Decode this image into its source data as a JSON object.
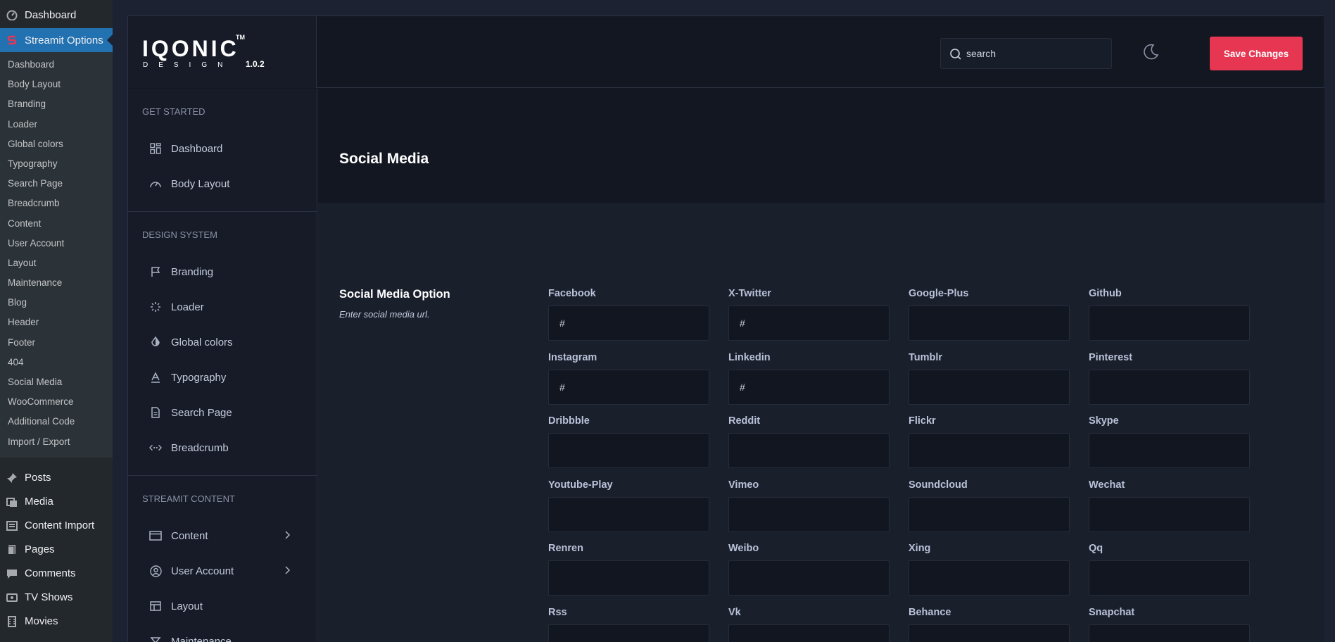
{
  "wp_sidebar": {
    "top_item": {
      "label": "Dashboard",
      "icon": "dashboard-icon"
    },
    "active_item": {
      "label": "Streamit Options",
      "icon": "streamit-icon"
    },
    "submenu": [
      "Dashboard",
      "Body Layout",
      "Branding",
      "Loader",
      "Global colors",
      "Typography",
      "Search Page",
      "Breadcrumb",
      "Content",
      "User Account",
      "Layout",
      "Maintenance",
      "Blog",
      "Header",
      "Footer",
      "404",
      "Social Media",
      "WooCommerce",
      "Additional Code",
      "Import / Export"
    ],
    "menu": [
      {
        "label": "Posts",
        "icon": "pin-icon"
      },
      {
        "label": "Media",
        "icon": "media-icon"
      },
      {
        "label": "Content Import",
        "icon": "import-icon"
      },
      {
        "label": "Pages",
        "icon": "pages-icon"
      },
      {
        "label": "Comments",
        "icon": "comment-icon"
      },
      {
        "label": "TV Shows",
        "icon": "tv-icon"
      },
      {
        "label": "Movies",
        "icon": "film-icon"
      }
    ]
  },
  "brand": {
    "logo_text": "IQONIC",
    "tm": "TM",
    "sub": "DESIGN",
    "version": "1.0.2"
  },
  "topbar": {
    "search_placeholder": "search",
    "save_label": "Save Changes",
    "theme_icon": "moon-icon"
  },
  "colors": {
    "accent": "#e63652",
    "wp_active": "#2271b1",
    "panel_bg": "#131722"
  },
  "nav": {
    "sections": [
      {
        "heading": "GET STARTED",
        "items": [
          {
            "label": "Dashboard",
            "icon": "grid-icon"
          },
          {
            "label": "Body Layout",
            "icon": "gauge-icon"
          }
        ]
      },
      {
        "heading": "DESIGN SYSTEM",
        "items": [
          {
            "label": "Branding",
            "icon": "flag-icon"
          },
          {
            "label": "Loader",
            "icon": "loader-icon"
          },
          {
            "label": "Global colors",
            "icon": "color-drop-icon"
          },
          {
            "label": "Typography",
            "icon": "typography-icon"
          },
          {
            "label": "Search Page",
            "icon": "document-icon"
          },
          {
            "label": "Breadcrumb",
            "icon": "breadcrumb-icon"
          }
        ]
      },
      {
        "heading": "STREAMIT CONTENT",
        "items": [
          {
            "label": "Content",
            "icon": "window-icon",
            "expandable": true
          },
          {
            "label": "User Account",
            "icon": "user-circle-icon",
            "expandable": true
          },
          {
            "label": "Layout",
            "icon": "layout-icon"
          },
          {
            "label": "Maintenance",
            "icon": "maintenance-icon"
          }
        ]
      }
    ]
  },
  "page": {
    "title": "Social Media",
    "section_title": "Social Media Option",
    "section_desc": "Enter social media url.",
    "fields": [
      {
        "label": "Facebook",
        "value": "#"
      },
      {
        "label": "X-Twitter",
        "value": "#"
      },
      {
        "label": "Google-Plus",
        "value": ""
      },
      {
        "label": "Github",
        "value": ""
      },
      {
        "label": "Instagram",
        "value": "#"
      },
      {
        "label": "Linkedin",
        "value": "#"
      },
      {
        "label": "Tumblr",
        "value": ""
      },
      {
        "label": "Pinterest",
        "value": ""
      },
      {
        "label": "Dribbble",
        "value": ""
      },
      {
        "label": "Reddit",
        "value": ""
      },
      {
        "label": "Flickr",
        "value": ""
      },
      {
        "label": "Skype",
        "value": ""
      },
      {
        "label": "Youtube-Play",
        "value": ""
      },
      {
        "label": "Vimeo",
        "value": ""
      },
      {
        "label": "Soundcloud",
        "value": ""
      },
      {
        "label": "Wechat",
        "value": ""
      },
      {
        "label": "Renren",
        "value": ""
      },
      {
        "label": "Weibo",
        "value": ""
      },
      {
        "label": "Xing",
        "value": ""
      },
      {
        "label": "Qq",
        "value": ""
      },
      {
        "label": "Rss",
        "value": ""
      },
      {
        "label": "Vk",
        "value": ""
      },
      {
        "label": "Behance",
        "value": ""
      },
      {
        "label": "Snapchat",
        "value": ""
      }
    ]
  }
}
